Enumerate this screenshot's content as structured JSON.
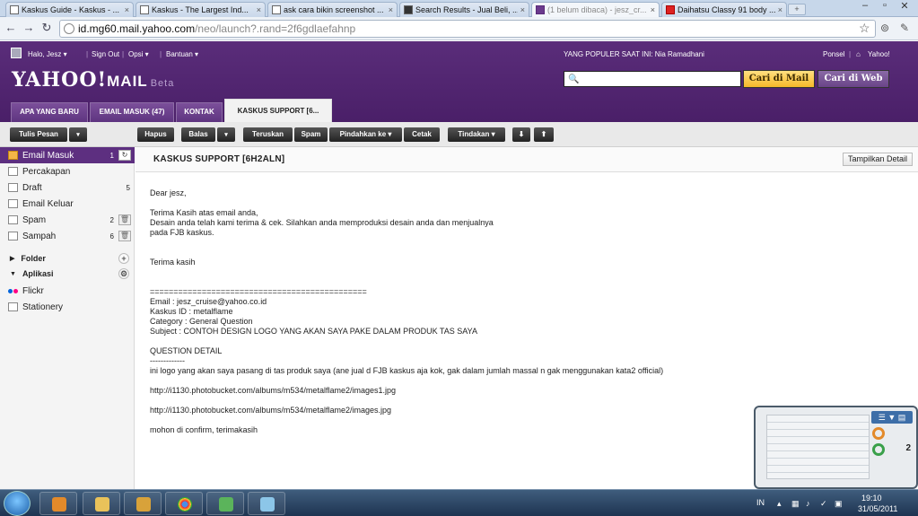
{
  "browser": {
    "tabs": [
      {
        "label": "Kaskus Guide - Kaskus - ...",
        "favicon": "kaskus-icon"
      },
      {
        "label": "Kaskus - The Largest Ind...",
        "favicon": "kaskus-icon"
      },
      {
        "label": "ask cara bikin screenshot ...",
        "favicon": "kaskus-icon"
      },
      {
        "label": "Search Results - Jual Beli, ...",
        "favicon": "kaskus-dark-icon"
      },
      {
        "label": "(1 belum dibaca) - jesz_cr...",
        "favicon": "yahoo-icon"
      },
      {
        "label": "Daihatsu Classy 91 body ...",
        "favicon": "red-icon"
      }
    ],
    "tab_close": "×",
    "new_tab": "+",
    "window_controls": {
      "minimize": "–",
      "maximize": "▫",
      "close": "✕"
    },
    "nav": {
      "back": "←",
      "forward": "→",
      "reload": "↻"
    },
    "url_host": "id.mg60.mail.yahoo.com",
    "url_path": "/neo/launch?.rand=2f6gdlaefahnp",
    "star": "☆"
  },
  "yahoo": {
    "greeting": "Halo, Jesz ▾",
    "sign_out": "Sign Out",
    "options": "Opsi ▾",
    "help": "Bantuan ▾",
    "popular": "YANG POPULER SAAT INI: Nia Ramadhani",
    "mobile": "Ponsel",
    "home": "Yahoo!",
    "logo": "YAHOO!",
    "logo_mail": "MAIL",
    "logo_beta": "Beta",
    "search_placeholder": "",
    "search_mail_btn": "Cari di Mail",
    "search_web_btn": "Cari di Web",
    "tabs": [
      {
        "label": "APA YANG BARU"
      },
      {
        "label": "EMAIL MASUK (47)"
      },
      {
        "label": "KONTAK"
      },
      {
        "label": "KASKUS SUPPORT [6..."
      }
    ]
  },
  "toolbar": {
    "compose": "Tulis Pesan",
    "delete": "Hapus",
    "reply": "Balas",
    "forward": "Teruskan",
    "spam": "Spam",
    "move": "Pindahkan ke ▾",
    "print": "Cetak",
    "actions": "Tindakan ▾",
    "down": "⬇",
    "up": "⬆",
    "caret": "▾"
  },
  "sidebar": {
    "items": [
      {
        "label": "Email Masuk",
        "count": "1",
        "action": "↻"
      },
      {
        "label": "Percakapan",
        "count": "",
        "action": ""
      },
      {
        "label": "Draft",
        "count": "5",
        "action": ""
      },
      {
        "label": "Email Keluar",
        "count": "",
        "action": ""
      },
      {
        "label": "Spam",
        "count": "2",
        "action": "🗑"
      },
      {
        "label": "Sampah",
        "count": "6",
        "action": "🗑"
      }
    ],
    "folder_head": "Folder",
    "apps_head": "Aplikasi",
    "apps": [
      {
        "label": "Flickr"
      },
      {
        "label": "Stationery"
      }
    ]
  },
  "message": {
    "subject": "KASKUS SUPPORT [6H2ALN]",
    "detail_btn": "Tampilkan Detail",
    "lines": [
      "Dear jesz,",
      "",
      "Terima Kasih atas email anda,",
      "Desain anda telah kami terima & cek. Silahkan anda memproduksi desain anda dan menjualnya",
      "pada FJB kaskus.",
      "",
      "",
      "Terima kasih",
      "",
      "",
      "==============================================",
      "Email : jesz_cruise@yahoo.co.id",
      "Kaskus ID : metalflame",
      "Category : General Question",
      "Subject : CONTOH DESIGN LOGO YANG AKAN SAYA PAKE DALAM PRODUK TAS SAYA",
      "",
      "QUESTION DETAIL",
      "-------------",
      "ini logo yang akan saya pasang di tas produk saya (ane jual d FJB kaskus aja kok, gak dalam jumlah massal n gak menggunakan kata2 official)",
      "",
      "http://i1130.photobucket.com/albums/m534/metalflame2/images1.jpg",
      "",
      "http://i1130.photobucket.com/albums/m534/metalflame2/images.jpg",
      "",
      "mohon di confirm, terimakasih"
    ]
  },
  "gadget": {
    "count": "2",
    "controls": "☰ ▼ ▤"
  },
  "taskbar": {
    "lang": "IN",
    "time": "19:10",
    "date": "31/05/2011"
  },
  "colors": {
    "yahoo_purple": "#4a1f68",
    "active_folder": "#5d2f80",
    "search_mail": "#f6b92a"
  }
}
